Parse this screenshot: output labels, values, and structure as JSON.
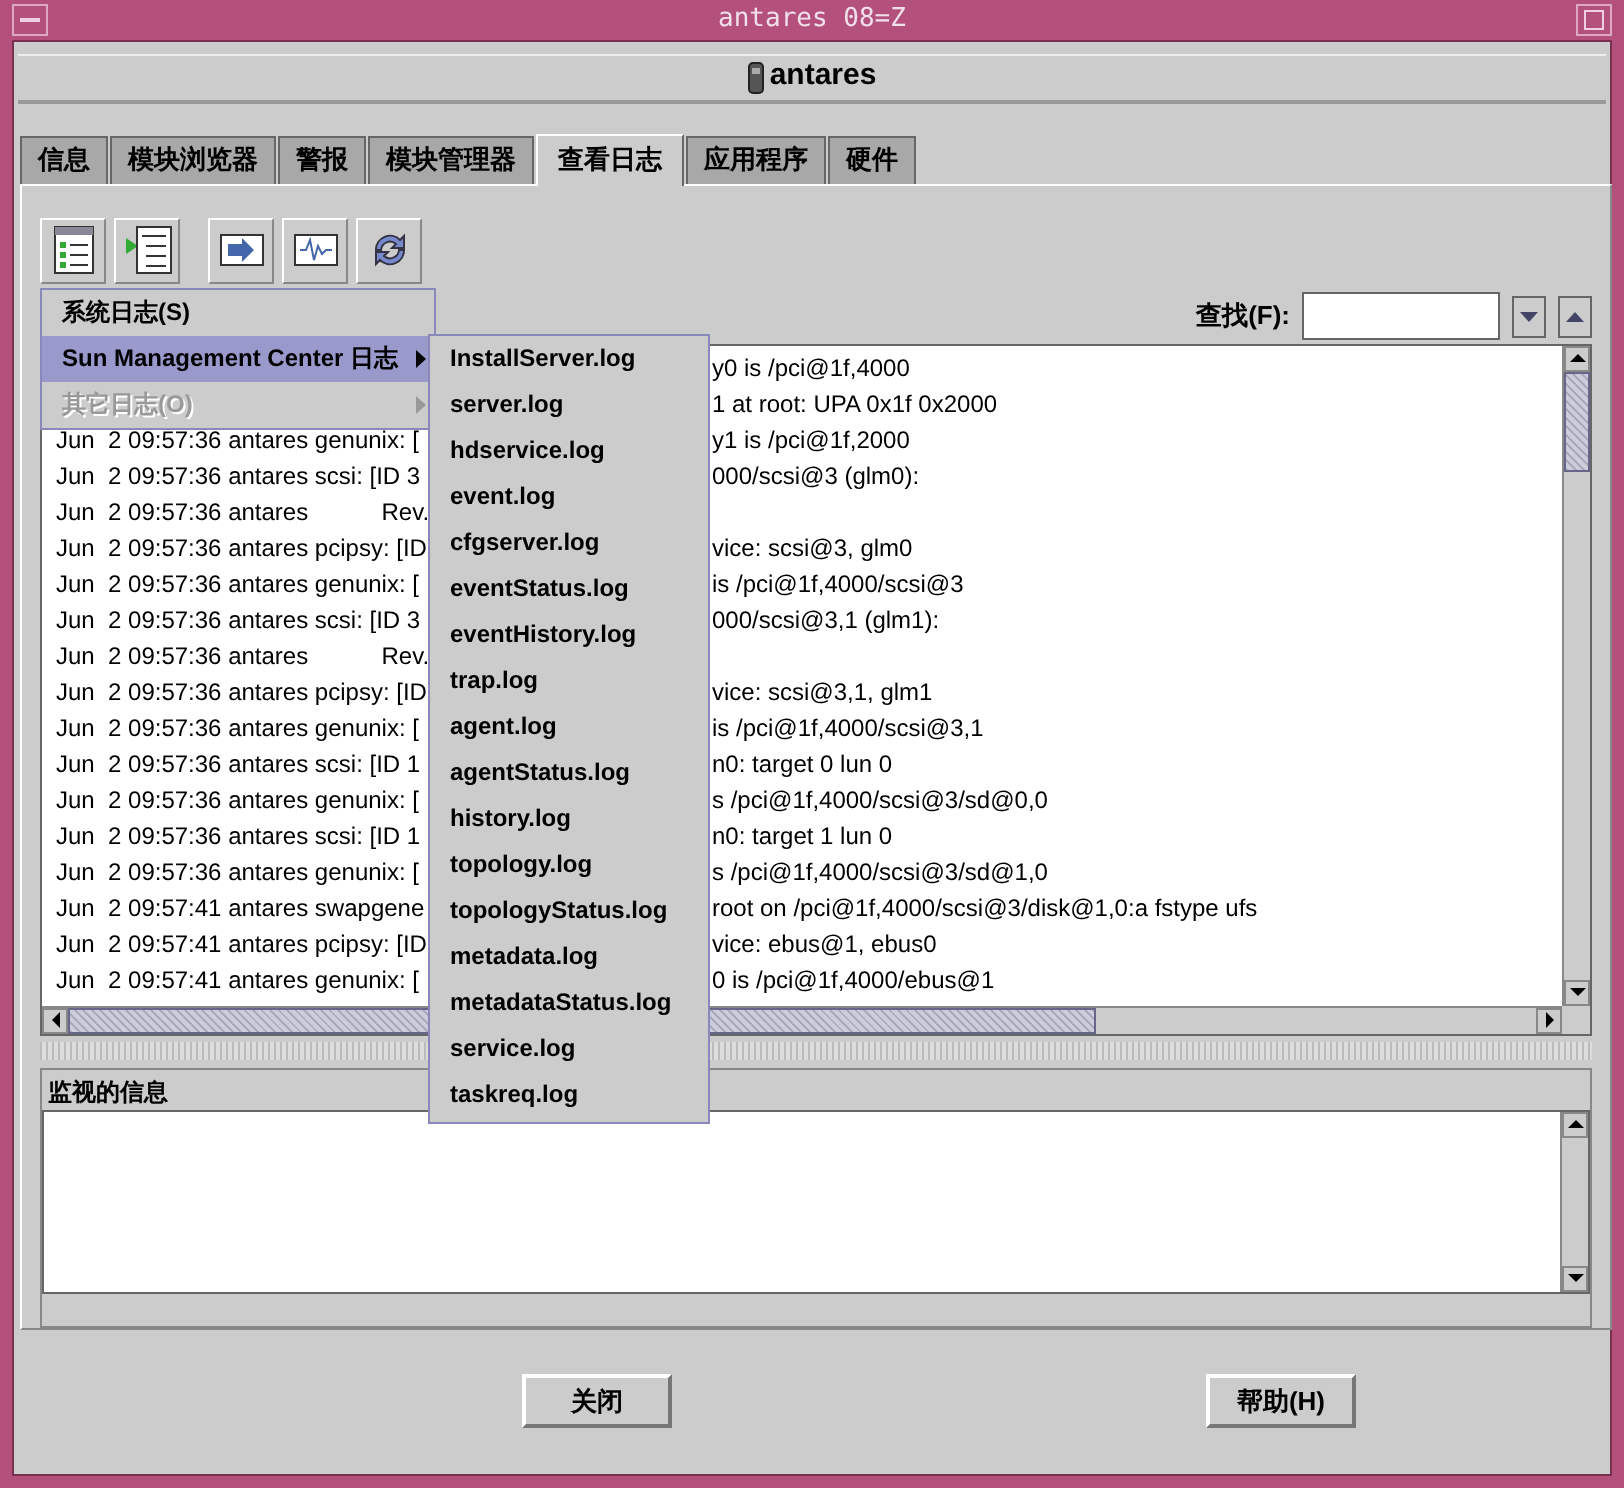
{
  "window": {
    "title": "antares 08=Z"
  },
  "host": {
    "name": "antares"
  },
  "tabs": [
    {
      "label": "信息",
      "selected": false
    },
    {
      "label": "模块浏览器",
      "selected": false
    },
    {
      "label": "警报",
      "selected": false
    },
    {
      "label": "模块管理器",
      "selected": false
    },
    {
      "label": "查看日志",
      "selected": true
    },
    {
      "label": "应用程序",
      "selected": false
    },
    {
      "label": "硬件",
      "selected": false
    }
  ],
  "menu": {
    "items": [
      {
        "label": "系统日志(S)",
        "kind": "item",
        "selected": false,
        "disabled": false
      },
      {
        "label": "Sun Management Center 日志",
        "kind": "submenu",
        "selected": true,
        "disabled": false
      },
      {
        "label": "其它日志(O)",
        "kind": "submenu",
        "selected": false,
        "disabled": true
      }
    ]
  },
  "submenu": {
    "items": [
      "InstallServer.log",
      "server.log",
      "hdservice.log",
      "event.log",
      "cfgserver.log",
      "eventStatus.log",
      "eventHistory.log",
      "trap.log",
      "agent.log",
      "agentStatus.log",
      "history.log",
      "topology.log",
      "topologyStatus.log",
      "metadata.log",
      "metadataStatus.log",
      "service.log",
      "taskreq.log"
    ]
  },
  "find": {
    "label": "查找(F):"
  },
  "log": {
    "rows": [
      {
        "left": "",
        "right": "y0 is /pci@1f,4000"
      },
      {
        "left": "",
        "right": "1 at root: UPA 0x1f 0x2000"
      },
      {
        "left": "Jun  2 09:57:36 antares genunix: [",
        "right": "y1 is /pci@1f,2000"
      },
      {
        "left": "Jun  2 09:57:36 antares scsi: [ID 3",
        "right": "000/scsi@3 (glm0):"
      },
      {
        "left": "Jun  2 09:57:36 antares           Rev.",
        "right": ""
      },
      {
        "left": "Jun  2 09:57:36 antares pcipsy: [ID",
        "right": "vice: scsi@3, glm0"
      },
      {
        "left": "Jun  2 09:57:36 antares genunix: [",
        "right": "is /pci@1f,4000/scsi@3"
      },
      {
        "left": "Jun  2 09:57:36 antares scsi: [ID 3",
        "right": "000/scsi@3,1 (glm1):"
      },
      {
        "left": "Jun  2 09:57:36 antares           Rev.",
        "right": ""
      },
      {
        "left": "Jun  2 09:57:36 antares pcipsy: [ID",
        "right": "vice: scsi@3,1, glm1"
      },
      {
        "left": "Jun  2 09:57:36 antares genunix: [",
        "right": "is /pci@1f,4000/scsi@3,1"
      },
      {
        "left": "Jun  2 09:57:36 antares scsi: [ID 1",
        "right": "n0: target 0 lun 0"
      },
      {
        "left": "Jun  2 09:57:36 antares genunix: [",
        "right": "s /pci@1f,4000/scsi@3/sd@0,0"
      },
      {
        "left": "Jun  2 09:57:36 antares scsi: [ID 1",
        "right": "n0: target 1 lun 0"
      },
      {
        "left": "Jun  2 09:57:36 antares genunix: [",
        "right": "s /pci@1f,4000/scsi@3/sd@1,0"
      },
      {
        "left": "Jun  2 09:57:41 antares swapgene",
        "right": "root on /pci@1f,4000/scsi@3/disk@1,0:a fstype ufs"
      },
      {
        "left": "Jun  2 09:57:41 antares pcipsy: [ID",
        "right": "vice: ebus@1, ebus0"
      },
      {
        "left": "Jun  2 09:57:41 antares genunix: [",
        "right": "0 is /pci@1f,4000/ebus@1"
      }
    ]
  },
  "monitor": {
    "title": "监视的信息"
  },
  "buttons": [
    "关闭",
    "帮助(H)"
  ]
}
